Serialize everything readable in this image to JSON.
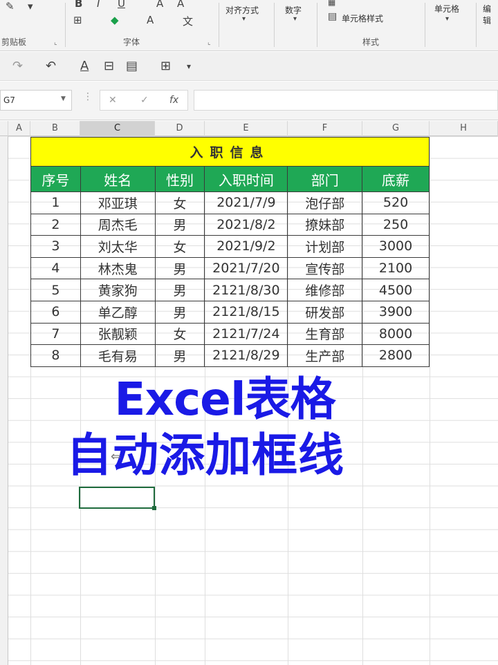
{
  "ribbon": {
    "clipboard_label": "剪贴板",
    "font_label": "字体",
    "align_label": "对齐方式",
    "number_label": "数字",
    "styles_label": "样式",
    "cell_styles": "单元格样式",
    "cells_label": "单元格",
    "editing_label": "编辑"
  },
  "namebox": {
    "value": "G7"
  },
  "columns": [
    "A",
    "B",
    "C",
    "D",
    "E",
    "F",
    "G",
    "H"
  ],
  "table": {
    "title": "入职信息",
    "headers": [
      "序号",
      "姓名",
      "性别",
      "入职时间",
      "部门",
      "底薪"
    ],
    "rows": [
      [
        "1",
        "邓亚琪",
        "女",
        "2021/7/9",
        "泡仔部",
        "520"
      ],
      [
        "2",
        "周杰毛",
        "男",
        "2021/8/2",
        "撩妹部",
        "250"
      ],
      [
        "3",
        "刘太华",
        "女",
        "2021/9/2",
        "计划部",
        "3000"
      ],
      [
        "4",
        "林杰鬼",
        "男",
        "2021/7/20",
        "宣传部",
        "2100"
      ],
      [
        "5",
        "黄家狗",
        "男",
        "2121/8/30",
        "维修部",
        "4500"
      ],
      [
        "6",
        "单乙醇",
        "男",
        "2121/8/15",
        "研发部",
        "3900"
      ],
      [
        "7",
        "张靓颖",
        "女",
        "2121/7/24",
        "生育部",
        "8000"
      ],
      [
        "8",
        "毛有易",
        "男",
        "2121/8/29",
        "生产部",
        "2800"
      ]
    ]
  },
  "overlay": {
    "line1": "Excel表格",
    "line2": "自动添加框线"
  },
  "colors": {
    "title_bg": "#ffff00",
    "header_bg": "#1fa855",
    "overlay_text": "#1a1ae6"
  }
}
